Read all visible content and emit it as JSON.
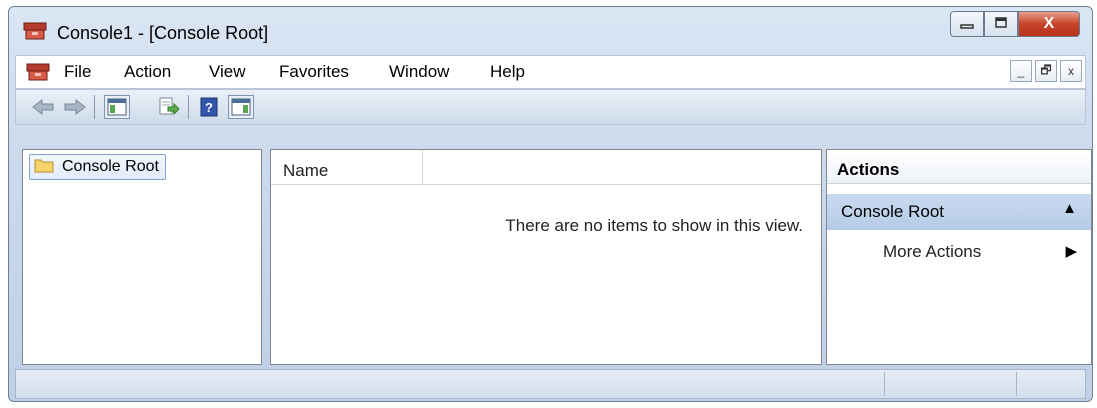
{
  "window": {
    "title": "Console1 - [Console Root]",
    "minimize_icon": "minimize-icon",
    "maximize_icon": "maximize-icon",
    "close_label": "X"
  },
  "menu": {
    "items": [
      "File",
      "Action",
      "View",
      "Favorites",
      "Window",
      "Help"
    ]
  },
  "mdi_controls": {
    "minimize_label": "_",
    "restore_label": "🗗",
    "close_label": "x"
  },
  "toolbar": {
    "buttons": [
      "back-arrow-icon",
      "forward-arrow-icon",
      "show-hide-console-tree-icon",
      "export-list-icon",
      "help-icon",
      "show-hide-action-pane-icon"
    ]
  },
  "tree": {
    "root_label": "Console Root"
  },
  "list": {
    "column_name": "Name",
    "empty_message": "There are no items to show in this view."
  },
  "actions": {
    "title": "Actions",
    "section_label": "Console Root",
    "more_actions": "More Actions"
  },
  "colors": {
    "accent_section": "#c9daef",
    "close_button": "#c7432a",
    "folder": "#f5d36b"
  }
}
